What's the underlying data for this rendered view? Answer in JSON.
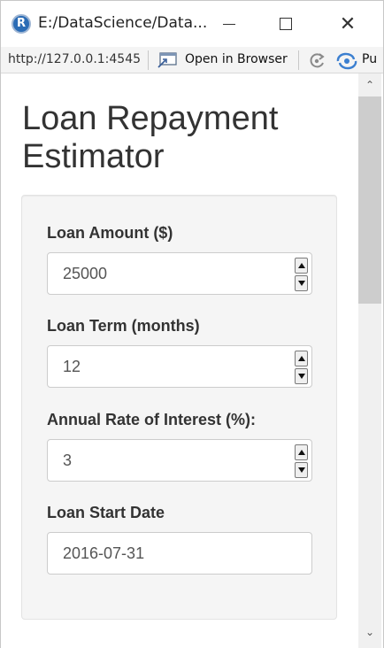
{
  "window": {
    "title": "E:/DataScience/Data...",
    "app_icon": "R-logo-icon",
    "app_icon_letter": "R"
  },
  "toolbar": {
    "url": "http://127.0.0.1:4545",
    "open_browser_label": "Open in Browser",
    "publish_label": "Pu"
  },
  "page": {
    "title": "Loan Repayment Estimator"
  },
  "form": {
    "loan_amount": {
      "label": "Loan Amount ($)",
      "value": "25000"
    },
    "loan_term": {
      "label": "Loan Term (months)",
      "value": "12"
    },
    "interest_rate": {
      "label": "Annual Rate of Interest (%):",
      "value": "3"
    },
    "start_date": {
      "label": "Loan Start Date",
      "value": "2016-07-31"
    }
  },
  "colors": {
    "accent_blue": "#2b6cb5",
    "well_bg": "#f5f5f5",
    "text": "#333333"
  }
}
